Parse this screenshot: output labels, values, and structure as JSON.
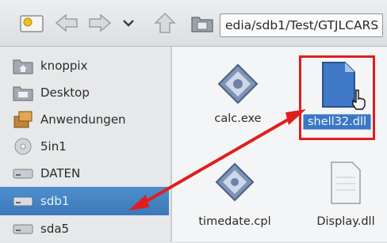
{
  "toolbar": {
    "path_text": "edia/sdb1/Test/GTJLCARS"
  },
  "sidebar": {
    "items": [
      {
        "label": "knoppix",
        "icon": "home-folder-icon"
      },
      {
        "label": "Desktop",
        "icon": "desktop-folder-icon"
      },
      {
        "label": "Anwendungen",
        "icon": "applications-icon"
      },
      {
        "label": "5in1",
        "icon": "disc-icon"
      },
      {
        "label": "DATEN",
        "icon": "drive-icon"
      },
      {
        "label": "sdb1",
        "icon": "drive-icon"
      },
      {
        "label": "sda5",
        "icon": "drive-icon"
      }
    ]
  },
  "files": [
    {
      "label": "calc.exe",
      "icon": "executable-icon"
    },
    {
      "label": "shell32.dll",
      "icon": "dll-file-icon"
    },
    {
      "label": "timedate.cpl",
      "icon": "executable-icon"
    },
    {
      "label": "Display.dll",
      "icon": "document-icon"
    }
  ],
  "colors": {
    "annotation": "#e21d1d",
    "selection": "#3b78b8"
  }
}
